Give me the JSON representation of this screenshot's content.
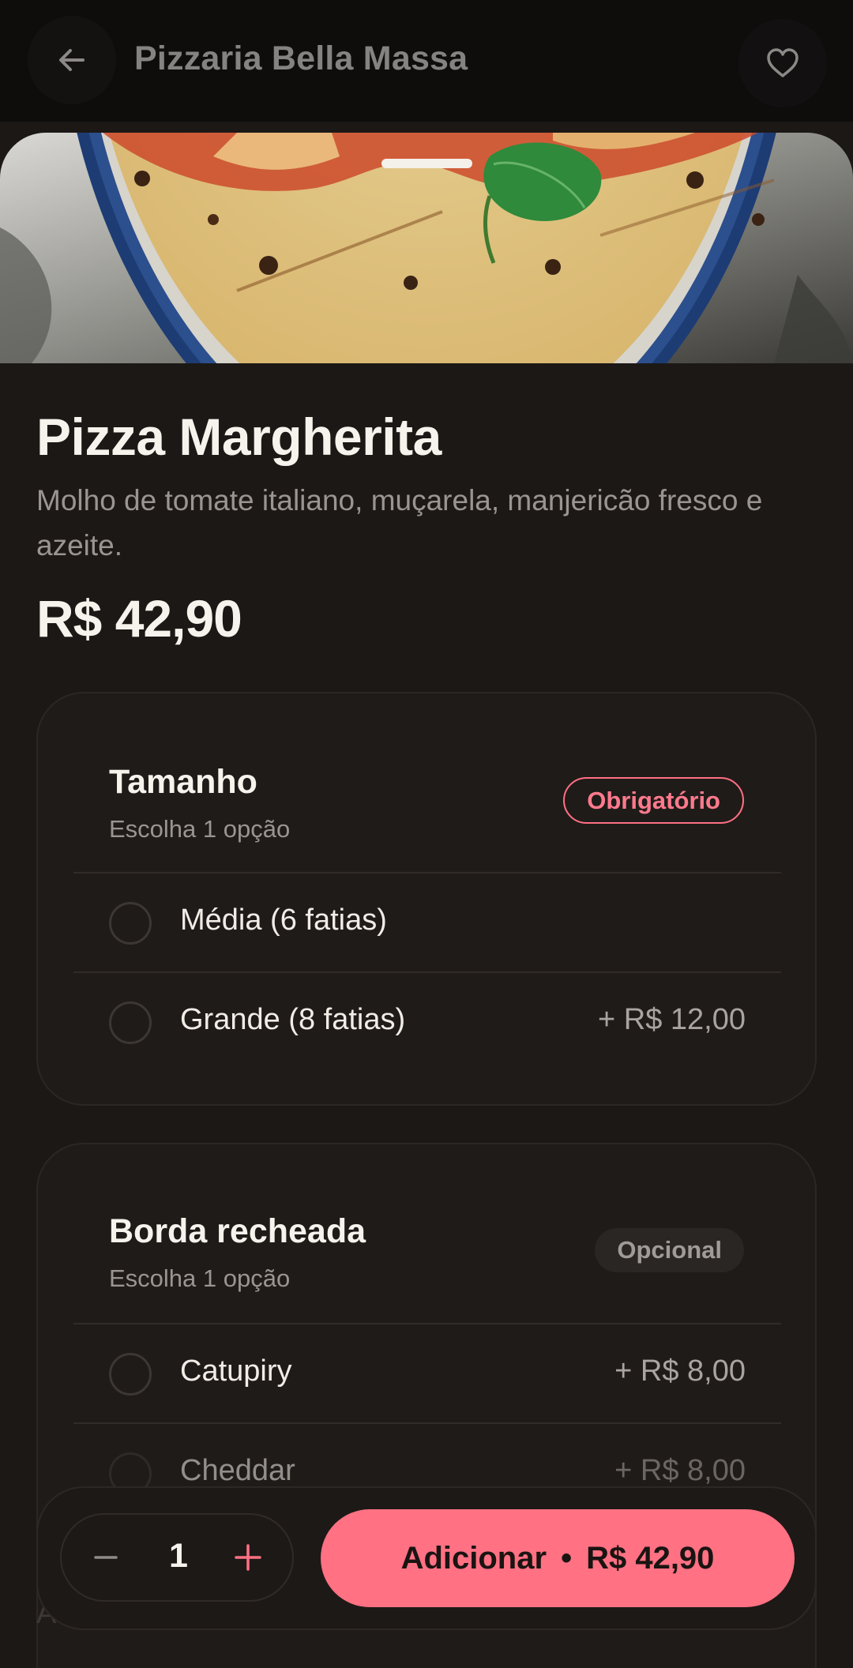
{
  "header": {
    "store_name": "Pizzaria Bella Massa",
    "back_icon": "arrow-left-icon",
    "favorite_icon": "heart-icon"
  },
  "hero": {
    "image": "pizza-margherita-photo"
  },
  "product": {
    "name": "Pizza Margherita",
    "description": "Molho de tomate italiano, muçarela, manjericão fresco e azeite.",
    "price": "R$ 42,90"
  },
  "groups": {
    "size": {
      "title": "Tamanho",
      "subtitle": "Escolha 1 opção",
      "badge": "Obrigatório",
      "options": [
        {
          "label": "Média (6 fatias)",
          "price": ""
        },
        {
          "label": "Grande (8 fatias)",
          "price": "+ R$ 12,00"
        }
      ]
    },
    "crust": {
      "title": "Borda recheada",
      "subtitle": "Escolha 1 opção",
      "badge": "Opcional",
      "options": [
        {
          "label": "Catupiry",
          "price": "+ R$ 8,00"
        },
        {
          "label": "Cheddar",
          "price": "+ R$ 8,00"
        }
      ]
    }
  },
  "cart": {
    "quantity": "1",
    "add_label": "Adicionar",
    "separator": "•",
    "total": "R$ 42,90"
  },
  "colors": {
    "accent": "#ff7183",
    "background": "#1c1816",
    "card": "#1f1b19"
  },
  "partial_text": "Ac"
}
